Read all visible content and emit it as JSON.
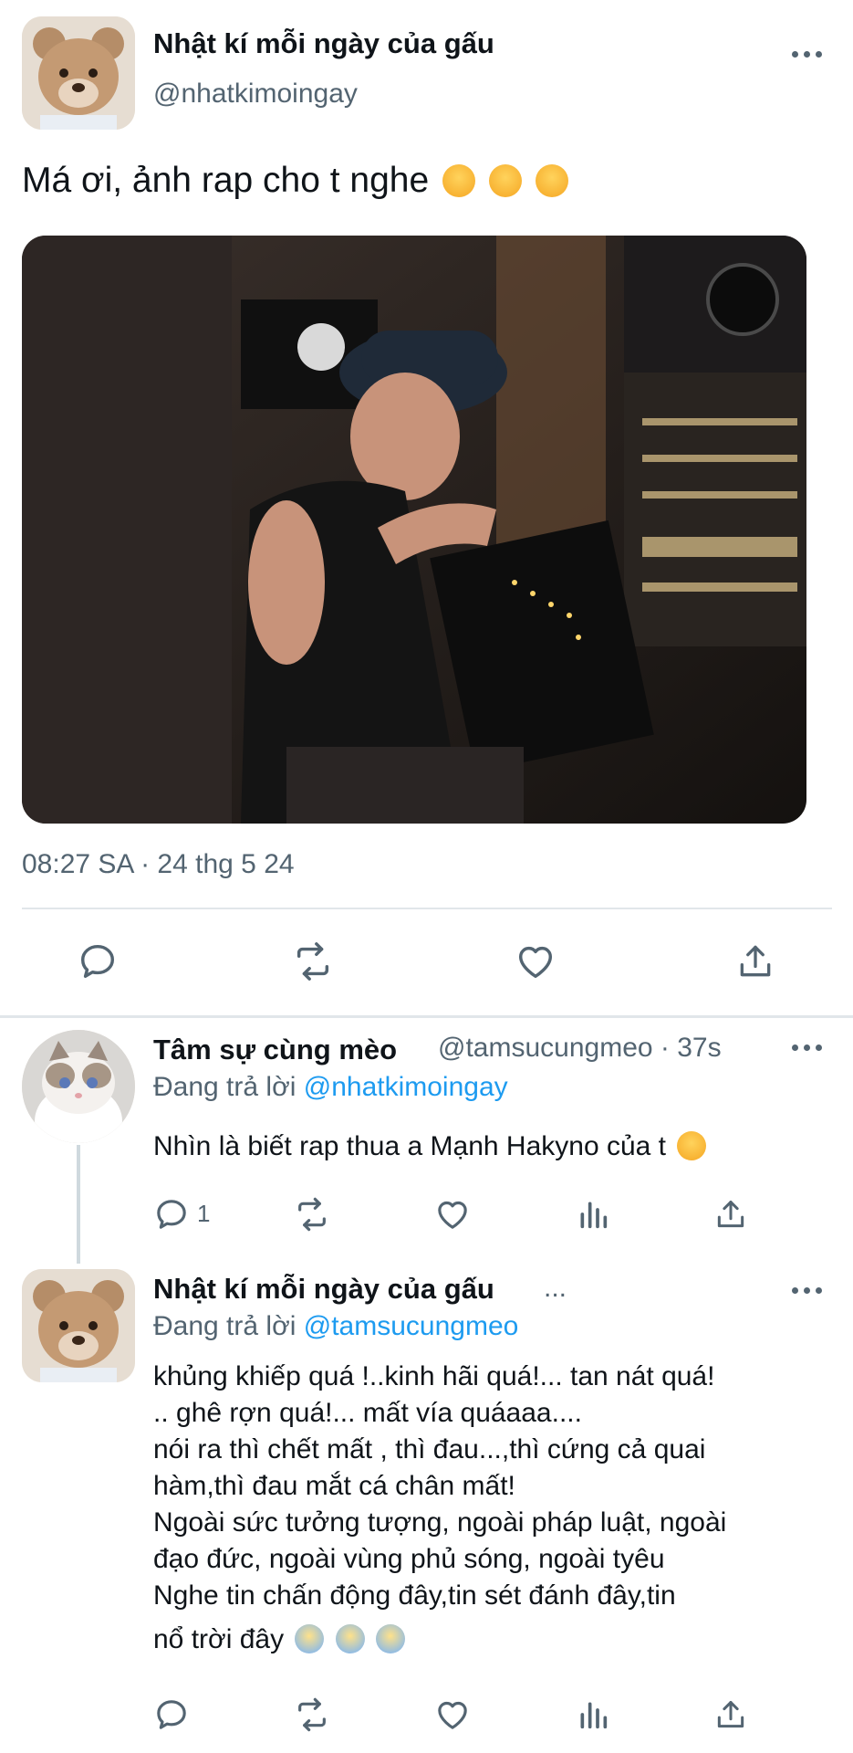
{
  "main_tweet": {
    "display_name": "Nhật kí mỗi ngày của gấu",
    "handle": "@nhatkimoingay",
    "text": "Má ơi, ảnh rap cho t nghe",
    "timestamp": "08:27 SA · 24 thg 5 24"
  },
  "reply1": {
    "display_name": "Tâm sự cùng mèo",
    "handle_time": "@tamsucungmeo · 37s",
    "replying_prefix": "Đang trả lời",
    "replying_to": "@nhatkimoingay",
    "text": "Nhìn là biết rap thua a Mạnh Hakyno của t",
    "reply_count": "1"
  },
  "reply2": {
    "display_name": "Nhật kí mỗi ngày của gấu",
    "ellipsis": "...",
    "replying_prefix": "Đang trả lời",
    "replying_to": "@tamsucungmeo",
    "lines": [
      "khủng khiếp quá !..kinh hãi quá!... tan nát quá!",
      ".. ghê rợn quá!... mất vía quáaaa....",
      "nói ra thì chết mất , thì đau...,thì cứng cả quai",
      "hàm,thì đau mắt cá chân mất!",
      "Ngoài sức tưởng tượng, ngoài pháp luật, ngoài",
      "đạo đức, ngoài vùng phủ sóng, ngoài tyêu",
      "Nghe tin chấn động đây,tin sét đánh đây,tin",
      "nổ trời đây"
    ]
  },
  "icons": [
    "reply-icon",
    "retweet-icon",
    "like-icon",
    "views-icon",
    "share-icon"
  ],
  "colors": {
    "accent": "#1d9bf0",
    "secondary_text": "#536471",
    "divider": "#e1e6ea"
  }
}
